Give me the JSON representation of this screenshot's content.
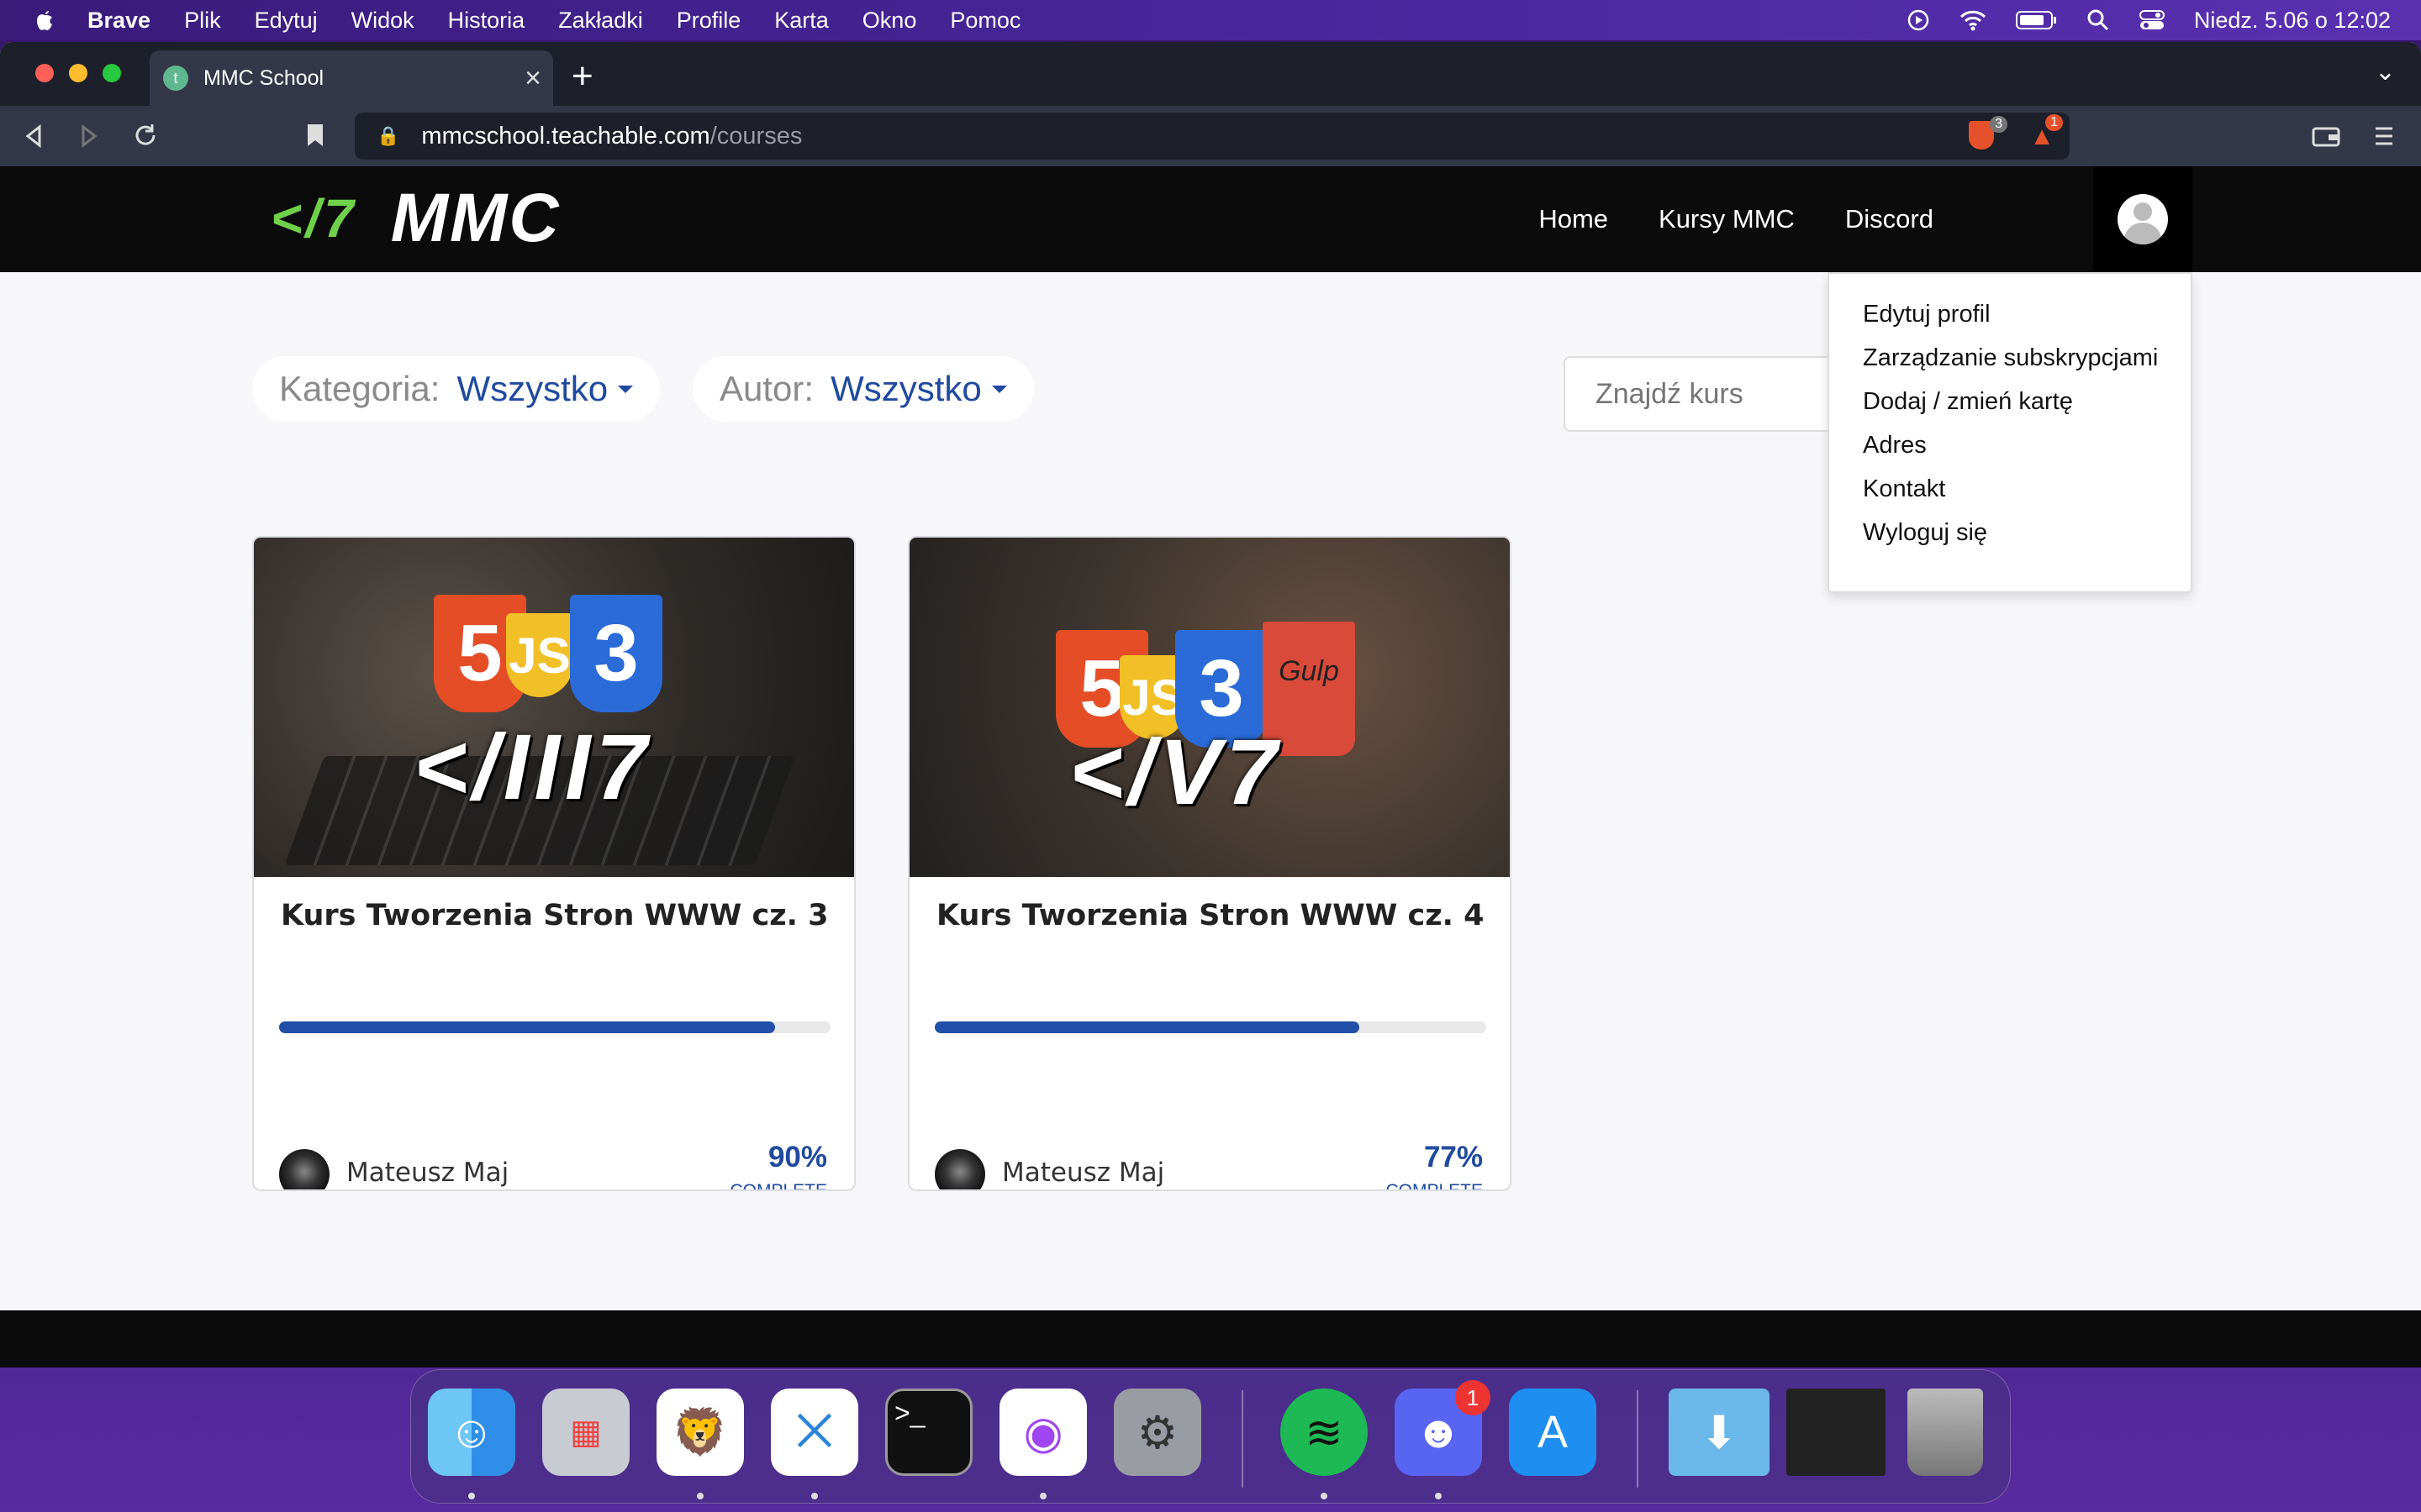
{
  "menubar": {
    "app": "Brave",
    "items": [
      "Plik",
      "Edytuj",
      "Widok",
      "Historia",
      "Zakładki",
      "Profile",
      "Karta",
      "Okno",
      "Pomoc"
    ],
    "clock": "Niedz. 5.06 o  12:02"
  },
  "browser": {
    "tab_title": "MMC School",
    "url_host": "mmcschool.teachable.com",
    "url_path": "/courses",
    "shields_count": "3",
    "rewards_count": "1"
  },
  "site": {
    "logo_mark": "</7",
    "logo_name": "MMC",
    "nav": [
      "Home",
      "Kursy MMC",
      "Discord"
    ]
  },
  "filters": {
    "category_label": "Kategoria:",
    "category_value": "Wszystko",
    "author_label": "Autor:",
    "author_value": "Wszystko",
    "search_placeholder": "Znajdź kurs"
  },
  "profile_menu": [
    "Edytuj profil",
    "Zarządzanie subskrypcjami",
    "Dodaj / zmień kartę",
    "Adres",
    "Kontakt",
    "Wyloguj się"
  ],
  "courses": [
    {
      "title": "Kurs Tworzenia Stron WWW cz. 3",
      "author": "Mateusz Maj",
      "percent": "90%",
      "progress": 0.9,
      "complete": "COMPLETE",
      "badge": "</III7"
    },
    {
      "title": "Kurs Tworzenia Stron WWW cz. 4",
      "author": "Mateusz Maj",
      "percent": "77%",
      "progress": 0.77,
      "complete": "COMPLETE",
      "badge": "</V7",
      "cup_text": "Gulp"
    }
  ],
  "dock": {
    "apps": [
      "finder-icon",
      "launchpad-icon",
      "brave-icon",
      "vscode-icon",
      "terminal-icon",
      "messenger-icon",
      "settings-icon",
      "spotify-icon",
      "discord-icon",
      "appstore-icon",
      "downloads-folder-icon",
      "window-preview",
      "trash-icon"
    ],
    "discord_badge": "1"
  },
  "colors": {
    "accent": "#1f4aa0",
    "logo_green": "#6fd14a",
    "progress": "#2250a8"
  }
}
